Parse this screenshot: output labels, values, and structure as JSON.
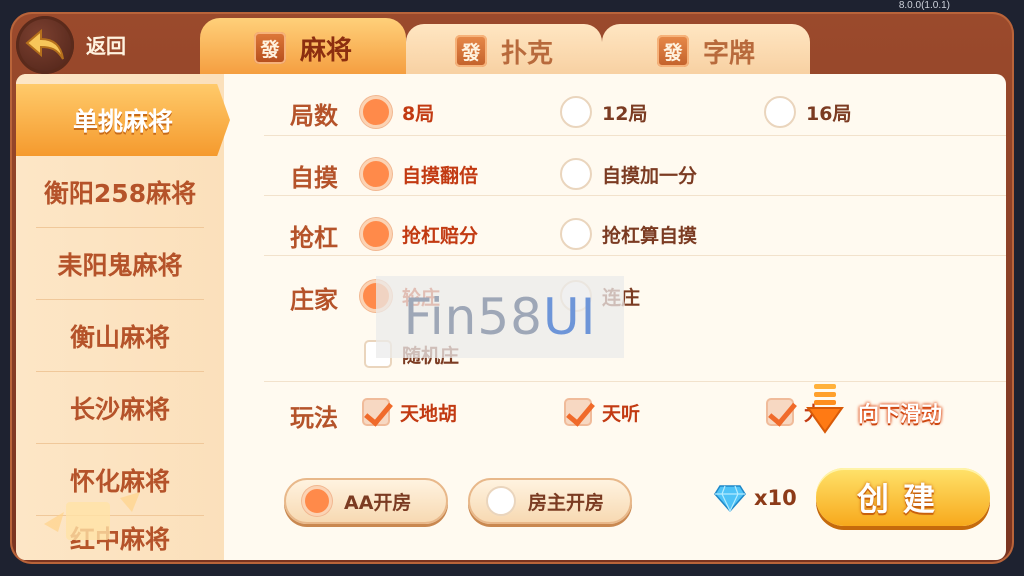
{
  "version": "8.0.0(1.0.1)",
  "header": {
    "back_label": "返回"
  },
  "tabs": [
    {
      "icon_char": "發",
      "label": "麻将",
      "active": true
    },
    {
      "icon_char": "發",
      "label": "扑克",
      "active": false
    },
    {
      "icon_char": "發",
      "label": "字牌",
      "active": false
    }
  ],
  "sidebar": {
    "items": [
      {
        "label": "单挑麻将",
        "active": true
      },
      {
        "label": "衡阳258麻将"
      },
      {
        "label": "耒阳鬼麻将"
      },
      {
        "label": "衡山麻将"
      },
      {
        "label": "长沙麻将"
      },
      {
        "label": "怀化麻将"
      },
      {
        "label": "红中麻将"
      }
    ]
  },
  "settings": {
    "rounds": {
      "label": "局数",
      "options": [
        "8局",
        "12局",
        "16局"
      ],
      "selected": 0
    },
    "zimo": {
      "label": "自摸",
      "options": [
        "自摸翻倍",
        "自摸加一分"
      ],
      "selected": 0
    },
    "qianggang": {
      "label": "抢杠",
      "options": [
        "抢杠赔分",
        "抢杠算自摸"
      ],
      "selected": 0
    },
    "dealer": {
      "label": "庄家",
      "options": [
        "轮庄",
        "连庄"
      ],
      "selected": 0,
      "random_label": "随机庄"
    },
    "play": {
      "label": "玩法",
      "options": [
        "天地胡",
        "天听",
        "大"
      ],
      "checked": [
        true,
        true,
        true
      ]
    }
  },
  "watermark": {
    "part1": "Fin58",
    "part2": "UI"
  },
  "scroll_hint": "向下滑动",
  "payment": {
    "options": [
      "AA开房",
      "房主开房"
    ],
    "selected": 0
  },
  "cost": {
    "icon": "diamond-icon",
    "amount": "x10"
  },
  "create_label": "创建"
}
